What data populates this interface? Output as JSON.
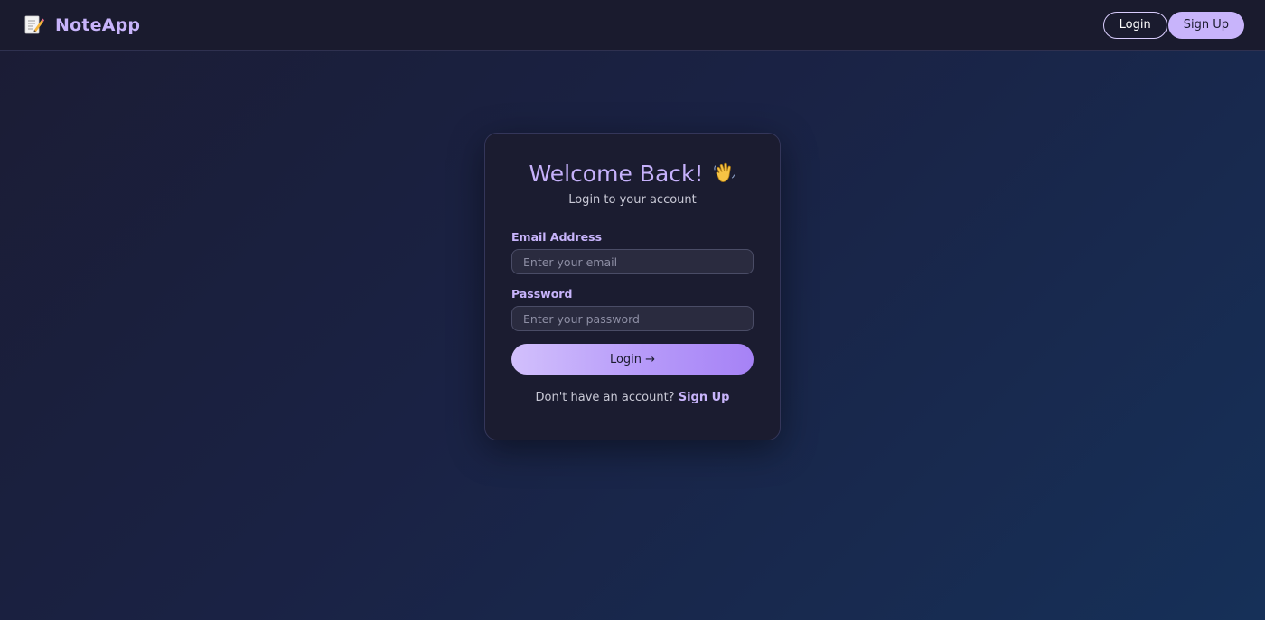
{
  "navbar": {
    "brand_icon": "memo-notepad-icon",
    "brand_name": "NoteApp",
    "login_label": "Login",
    "signup_label": "Sign Up"
  },
  "card": {
    "title": "Welcome Back!",
    "title_icon": "waving-hand-icon",
    "subtitle": "Login to your account",
    "email": {
      "label": "Email Address",
      "placeholder": "Enter your email",
      "value": ""
    },
    "password": {
      "label": "Password",
      "placeholder": "Enter your password",
      "value": ""
    },
    "login_button": "Login →",
    "signup_prompt": "Don't have an account?",
    "signup_link": "Sign Up"
  },
  "colors": {
    "accent": "#c8b4fb",
    "navbar_bg": "#1a1b2e",
    "card_bg": "#1b1c30",
    "input_bg": "#2a2b3f"
  }
}
